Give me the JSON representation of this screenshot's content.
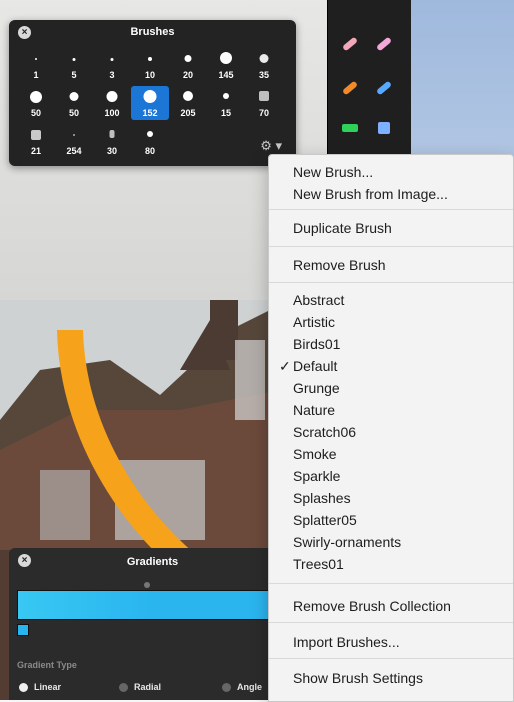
{
  "brushes_panel": {
    "title": "Brushes",
    "close_label": "×",
    "items": [
      {
        "size": "1"
      },
      {
        "size": "5"
      },
      {
        "size": "3"
      },
      {
        "size": "10"
      },
      {
        "size": "20"
      },
      {
        "size": "145"
      },
      {
        "size": "35"
      },
      {
        "size": "50"
      },
      {
        "size": "50"
      },
      {
        "size": "100"
      },
      {
        "size": "152",
        "selected": true
      },
      {
        "size": "205"
      },
      {
        "size": "15"
      },
      {
        "size": "70"
      },
      {
        "size": "21"
      },
      {
        "size": "254"
      },
      {
        "size": "30"
      },
      {
        "size": "80"
      }
    ],
    "gear_label": "⚙︎ ▾"
  },
  "gradients_panel": {
    "title": "Gradients",
    "close_label": "×",
    "gradient_type_label": "Gradient Type",
    "options": [
      {
        "label": "Linear",
        "selected": true
      },
      {
        "label": "Radial",
        "selected": false
      },
      {
        "label": "Angle",
        "selected": false
      }
    ]
  },
  "context_menu": {
    "items": [
      {
        "label": "New Brush...",
        "type": "item"
      },
      {
        "label": "New Brush from Image...",
        "type": "item"
      },
      {
        "type": "sep"
      },
      {
        "label": "Duplicate Brush",
        "type": "item"
      },
      {
        "type": "sep"
      },
      {
        "label": "Remove Brush",
        "type": "item"
      },
      {
        "type": "sep"
      },
      {
        "label": "Abstract",
        "type": "item"
      },
      {
        "label": "Artistic",
        "type": "item"
      },
      {
        "label": "Birds01",
        "type": "item"
      },
      {
        "label": "Default",
        "type": "item",
        "checked": true
      },
      {
        "label": "Grunge",
        "type": "item"
      },
      {
        "label": "Nature",
        "type": "item"
      },
      {
        "label": "Scratch06",
        "type": "item"
      },
      {
        "label": "Smoke",
        "type": "item"
      },
      {
        "label": "Sparkle",
        "type": "item"
      },
      {
        "label": "Splashes",
        "type": "item"
      },
      {
        "label": "Splatter05",
        "type": "item"
      },
      {
        "label": "Swirly-ornaments",
        "type": "item"
      },
      {
        "label": "Trees01",
        "type": "item"
      },
      {
        "type": "sep"
      },
      {
        "label": "Remove Brush Collection",
        "type": "item"
      },
      {
        "type": "sep"
      },
      {
        "label": "Import Brushes...",
        "type": "item"
      },
      {
        "type": "sep"
      },
      {
        "label": "Show Brush Settings",
        "type": "item"
      }
    ],
    "check_mark": "✓"
  },
  "tool_strip": {
    "tools": [
      {
        "name": "eraser-tool",
        "color": "#f2a8b8"
      },
      {
        "name": "eraser-tool-2",
        "color": "#f2a8d8"
      },
      {
        "name": "pencil-tool",
        "color": "#f08a2a"
      },
      {
        "name": "marker-tool",
        "color": "#59a8ff"
      },
      {
        "name": "fill-tool",
        "color": "#2ed25b"
      },
      {
        "name": "stamp-tool",
        "color": "#7fb0ff"
      }
    ]
  }
}
